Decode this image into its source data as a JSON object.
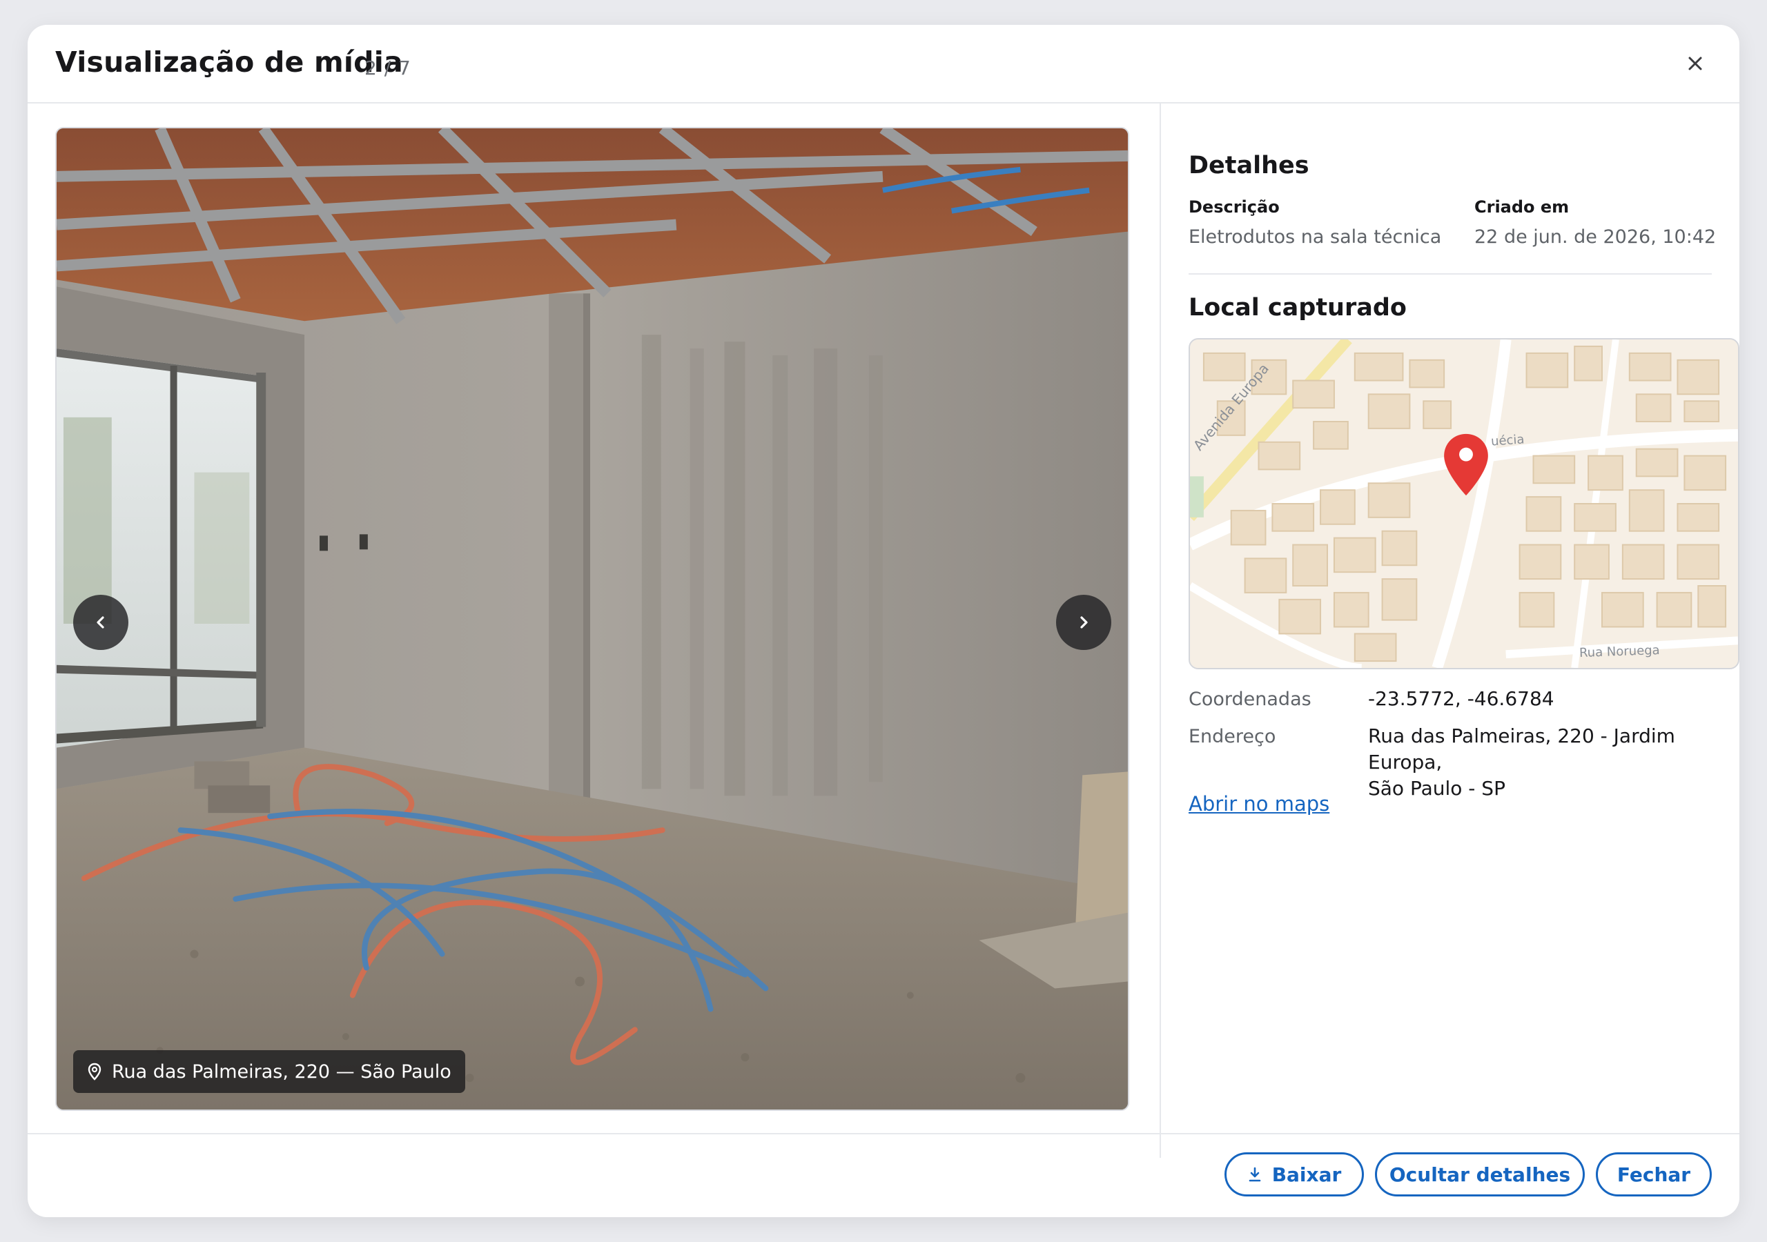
{
  "header": {
    "title": "Visualização de mídia",
    "counter": "2 / 7"
  },
  "viewer": {
    "caption": "Rua das Palmeiras, 220 — São Paulo"
  },
  "details": {
    "section_title": "Detalhes",
    "description_label": "Descrição",
    "description_value": "Eletrodutos na sala técnica",
    "created_label": "Criado em",
    "created_value": "22 de jun. de 2026, 10:42"
  },
  "location": {
    "section_title": "Local capturado",
    "map_labels": {
      "street_1": "Avenida Europa",
      "street_2": "uécia",
      "street_3": "Rua Noruega"
    },
    "coordinates_label": "Coordenadas",
    "coordinates_value": "-23.5772, -46.6784",
    "address_label": "Endereço",
    "address_line1": "Rua das Palmeiras, 220 - Jardim Europa,",
    "address_line2": "São Paulo - SP",
    "open_maps_link": "Abrir no maps"
  },
  "footer": {
    "download_label": "Baixar",
    "toggle_details_label": "Ocultar detalhes",
    "close_label": "Fechar"
  },
  "colors": {
    "accent": "#1565c0",
    "map_pin": "#e53935",
    "map_background": "#f6efe5",
    "map_buildings": "#ecdcc4"
  }
}
